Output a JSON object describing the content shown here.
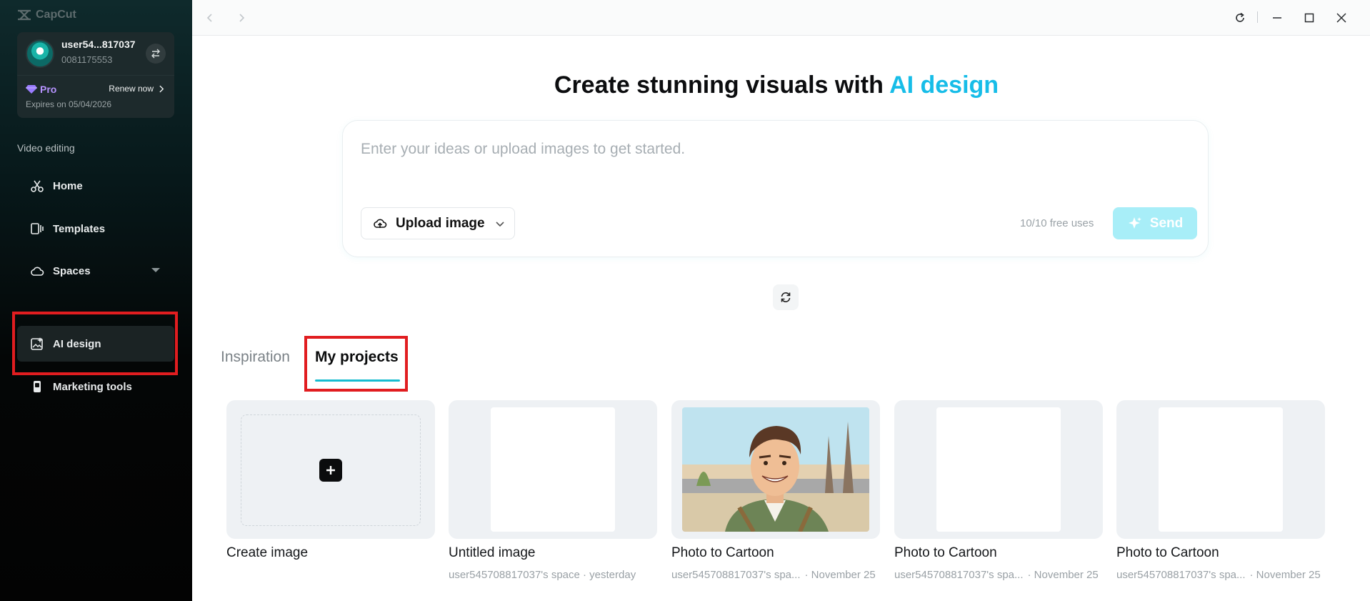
{
  "app": {
    "brand": "CapCut"
  },
  "account": {
    "username": "user54...817037",
    "user_id": "0081175553",
    "plan": "Pro",
    "renew_label": "Renew now",
    "expires": "Expires on 05/04/2026"
  },
  "sidebar": {
    "section_label": "Video editing",
    "items": [
      {
        "label": "Home",
        "icon": "scissors-icon"
      },
      {
        "label": "Templates",
        "icon": "templates-icon"
      },
      {
        "label": "Spaces",
        "icon": "cloud-icon"
      },
      {
        "label": "AI design",
        "icon": "ai-image-icon",
        "active": true
      },
      {
        "label": "Marketing tools",
        "icon": "marketing-icon"
      }
    ]
  },
  "main": {
    "headline_prefix": "Create stunning visuals with ",
    "headline_accent": "AI design",
    "prompt_placeholder": "Enter your ideas or upload images to get started.",
    "upload_label": "Upload image",
    "free_uses": "10/10 free uses",
    "send_label": "Send",
    "tabs": [
      {
        "label": "Inspiration",
        "active": false
      },
      {
        "label": "My projects",
        "active": true
      }
    ],
    "projects": [
      {
        "title": "Create image",
        "meta": "",
        "date": ""
      },
      {
        "title": "Untitled image",
        "meta": "user545708817037's space · yesterday",
        "date": ""
      },
      {
        "title": "Photo to Cartoon",
        "meta": "user545708817037's spa...",
        "date": "· November 25"
      },
      {
        "title": "Photo to Cartoon",
        "meta": "user545708817037's spa...",
        "date": "· November 25"
      },
      {
        "title": "Photo to Cartoon",
        "meta": "user545708817037's spa...",
        "date": "· November 25"
      }
    ]
  },
  "colors": {
    "accent": "#17bde8",
    "highlight": "#e11d20",
    "pro": "#b693ff",
    "send_bg": "#a8eef8"
  }
}
